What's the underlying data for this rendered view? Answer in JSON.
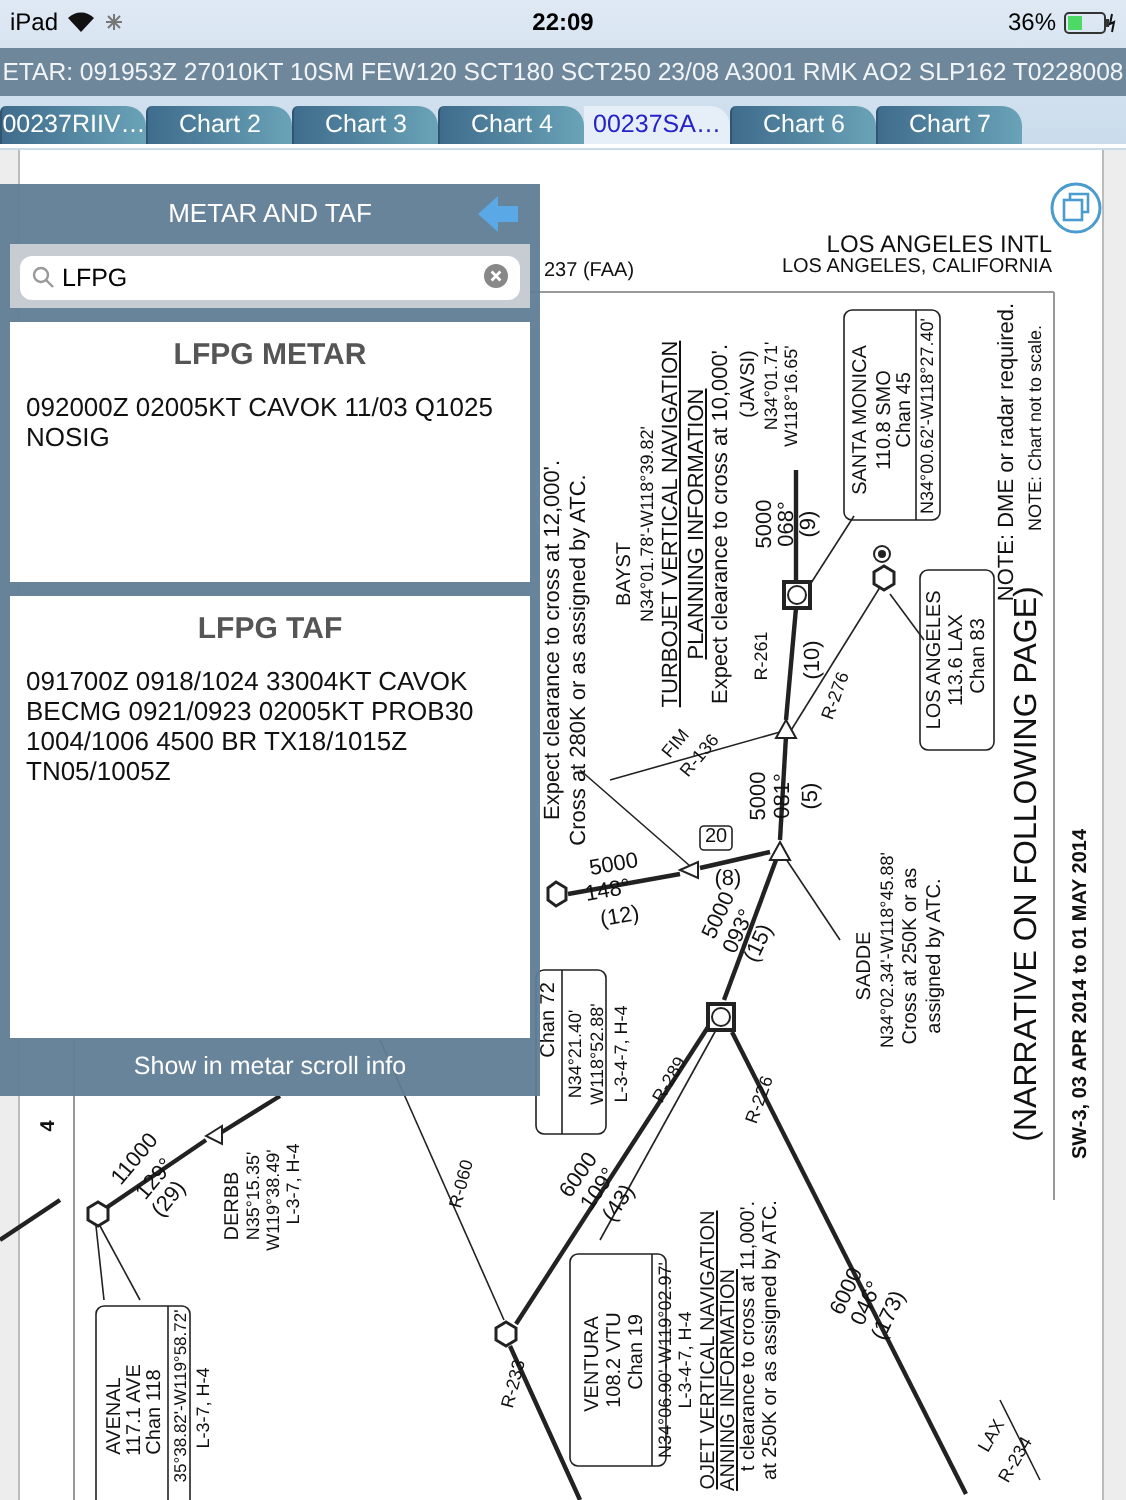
{
  "status_bar": {
    "device": "iPad",
    "time": "22:09",
    "battery": "36%"
  },
  "metar_banner": "ETAR: 091953Z 27010KT 10SM FEW120 SCT180 SCT250 23/08 A3001 RMK AO2 SLP162 T0228008",
  "tabs": [
    {
      "label": "00237RIIV…",
      "selected": false
    },
    {
      "label": "Chart 2",
      "selected": false
    },
    {
      "label": "Chart 3",
      "selected": false
    },
    {
      "label": "Chart 4",
      "selected": false
    },
    {
      "label": "00237SA…",
      "selected": true
    },
    {
      "label": "Chart 6",
      "selected": false
    },
    {
      "label": "Chart 7",
      "selected": false
    }
  ],
  "chart": {
    "header": [
      "237 (FAA)",
      "LOS ANGELES INTL",
      "LOS ANGELES, CALIFORNIA"
    ],
    "labels": [
      "Expect clearance to cross at 12,000'.",
      "Cross at 280K or as assigned by ATC.",
      "BAYST",
      "N34°01.78'-W118°39.82'",
      "TURBOJET VERTICAL NAVIGATION",
      "PLANNING INFORMATION",
      "Expect clearance to cross at 10,000'.",
      "(JAVSI)",
      "N34°01.71'",
      "W118°16.65'",
      "5000",
      "068°",
      "(9)",
      "R-261",
      "(10)",
      "R-276",
      "FIM",
      "R-136",
      "5000",
      "081°",
      "(5)",
      "NOTE: DME or radar required.",
      "NOTE: Chart not to scale.",
      "(NARRATIVE ON FOLLOWING PAGE)",
      "SW-3, 03 APR 2014 to 01 MAY 2014",
      "20",
      "(8)",
      "5000",
      "148°",
      "(12)",
      "5000",
      "093°",
      "(15)",
      "SADDE",
      "N34°02.34'-W118°45.88'",
      "Cross at 250K or as",
      "assigned by ATC.",
      "R-289",
      "R-226",
      "6000",
      "109°",
      "(43)",
      "6000",
      "046°",
      "(173)",
      "LAX",
      "R-234",
      "OJET VERTICAL NAVIGATION",
      "ANNING INFORMATION",
      "t clearance to cross at 11,000'.",
      "at 250K or as assigned by ATC.",
      "4",
      "11000",
      "129°",
      "(29)",
      "DERBB",
      "N35°15.35'",
      "W119°38.49'",
      "L-3-7, H-4",
      "R-060",
      "R-233",
      "SANTA MONICA",
      "110.8 SMO",
      "Chan 45",
      "N34°00.62'-W118°27.40'",
      "LOS ANGELES",
      "113.6 LAX",
      "Chan 83",
      "Chan 72",
      "N34°21.40'",
      "W118°52.88'",
      "L-3-4-7, H-4",
      "VENTURA",
      "108.2 VTU",
      "Chan 19",
      "N34°06.90'-W119°02.97'",
      "L-3-4-7, H-4",
      "AVENAL",
      "117.1 AVE",
      "Chan 118",
      "35°38.82'-W119°58.72'",
      "L-3-7, H-4"
    ]
  },
  "popup": {
    "title": "METAR AND TAF",
    "search": {
      "value": "LFPG"
    },
    "cards": [
      {
        "title": "LFPG METAR",
        "body": "092000Z 02005KT CAVOK 11/03 Q1025 NOSIG"
      },
      {
        "title": "LFPG TAF",
        "body": "091700Z 0918/1024 33004KT CAVOK BECMG 0921/0923 02005KT PROB30 1004/1006 4500 BR TX18/1015Z TN05/1005Z"
      }
    ],
    "footer": "Show in metar scroll info"
  }
}
